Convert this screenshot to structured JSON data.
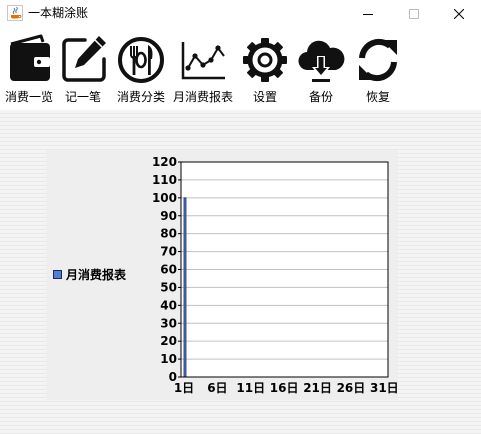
{
  "window": {
    "title": "一本糊涂账",
    "app_icon": "java-icon",
    "controls": [
      "minimize-icon",
      "maximize-icon",
      "close-icon"
    ]
  },
  "toolbar": {
    "items": [
      {
        "label": "消费一览",
        "icon": "wallet-icon"
      },
      {
        "label": "记一笔",
        "icon": "edit-icon"
      },
      {
        "label": "消费分类",
        "icon": "dining-icon"
      },
      {
        "label": "月消费报表",
        "icon": "line-chart-icon"
      },
      {
        "label": "设置",
        "icon": "gear-icon"
      },
      {
        "label": "备份",
        "icon": "cloud-download-icon"
      },
      {
        "label": "恢复",
        "icon": "refresh-icon"
      }
    ]
  },
  "chart_data": {
    "type": "bar",
    "legend": "月消费报表",
    "x_ticks": [
      "1日",
      "6日",
      "11日",
      "16日",
      "21日",
      "26日",
      "31日"
    ],
    "y_ticks": [
      "0",
      "10",
      "20",
      "30",
      "40",
      "50",
      "60",
      "70",
      "80",
      "90",
      "100",
      "110",
      "120"
    ],
    "ylim": [
      0,
      120
    ],
    "days": 31,
    "series": [
      {
        "name": "月消费报表",
        "x": [
          1
        ],
        "values": [
          100
        ],
        "color": "#4f7fd6"
      }
    ],
    "grid": true,
    "legend_position": "left"
  }
}
